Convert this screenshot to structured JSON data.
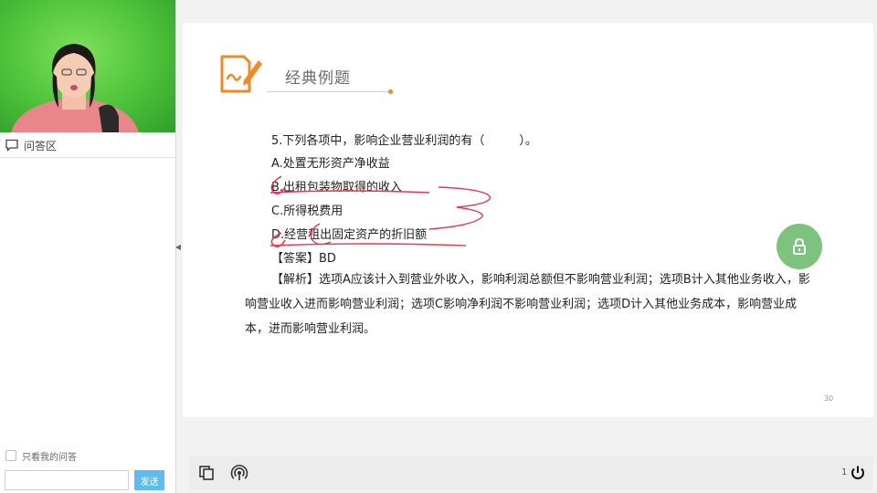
{
  "sidebar": {
    "qa_title": "问答区",
    "only_mine_label": "只看我的问答",
    "input_value": "",
    "send_label": "发送"
  },
  "slide": {
    "heading": "经典例题",
    "question": "5.下列各项中，影响企业营业利润的有（",
    "question_end": "）。",
    "options": [
      "A.处置无形资产净收益",
      "B.出租包装物取得的收入",
      "C.所得税费用",
      "D.经营租出固定资产的折旧额"
    ],
    "answer_label": "【答案】",
    "answer_value": "BD",
    "analysis_label": "【解析】",
    "analysis_text": "选项A应该计入到营业外收入，影响利润总额但不影响营业利润；选项B计入其他业务收入，影响营业收入进而影响营业利润；选项C影响净利润不影响营业利润；选项D计入其他业务成本，影响营业成本，进而影响营业利润。",
    "page_number": "30"
  },
  "toolbar": {
    "page_counter": "1"
  },
  "icons": {
    "qa": "chat-bubble-icon",
    "lock": "lock-icon",
    "copy": "copy-icon",
    "broadcast": "broadcast-icon",
    "power": "power-icon",
    "logo": "pen-paper-icon"
  },
  "colors": {
    "accent_orange": "#f28a21",
    "annotation_red": "#e23a4a",
    "lock_green": "#7cc47d",
    "send_blue": "#5dbcf0",
    "video_green": "#4cc23a"
  }
}
